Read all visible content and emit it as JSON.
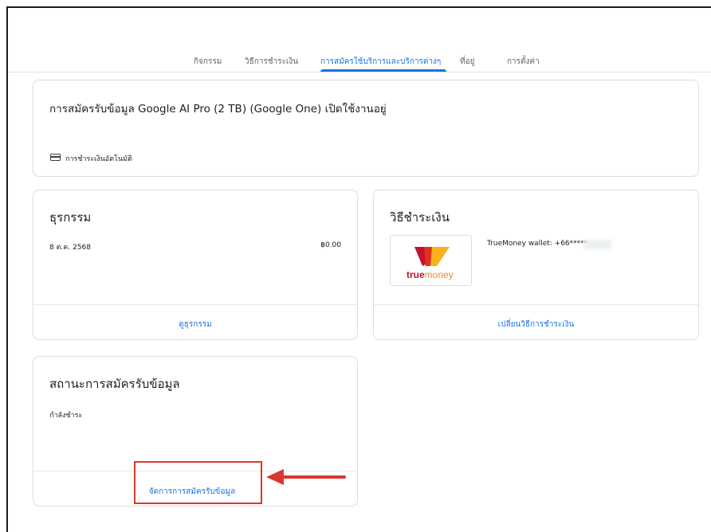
{
  "tabs": [
    {
      "label": "กิจกรรม",
      "active": false
    },
    {
      "label": "วิธีการชำระเงิน",
      "active": false
    },
    {
      "label": "การสมัครใช้บริการและบริการต่างๆ",
      "active": true
    },
    {
      "label": "ที่อยู่",
      "active": false
    },
    {
      "label": "การตั้งค่า",
      "active": false
    }
  ],
  "subscription": {
    "title": "การสมัครรับข้อมูล Google AI Pro (2 TB) (Google One) เปิดใช้งานอยู่",
    "autopay_label": "การชำระเงินอัตโนมัติ"
  },
  "transactions": {
    "title": "ธุรกรรม",
    "date": "8 ต.ค. 2568",
    "amount": "฿0.00",
    "link": "ดูธุรกรรม"
  },
  "payment": {
    "title": "วิธีชำระเงิน",
    "method_text": "TrueMoney wallet: +66*****",
    "logo_text_1": "true",
    "logo_text_2": "money",
    "link": "เปลี่ยนวิธีการชำระเงิน"
  },
  "status": {
    "title": "สถานะการสมัครรับข้อมูล",
    "value": "กำลังชำระ",
    "link": "จัดการการสมัครรับข้อมูล"
  },
  "colors": {
    "accent": "#1a73e8",
    "annotation": "#d9372b"
  }
}
